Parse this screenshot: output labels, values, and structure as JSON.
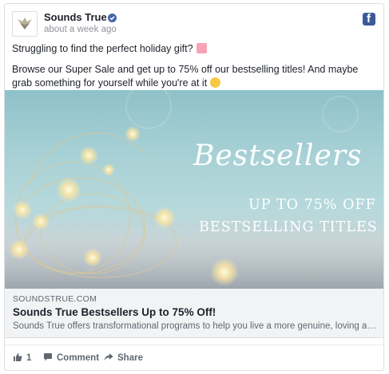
{
  "post": {
    "page_name": "Sounds True",
    "timestamp": "about a week ago",
    "message_line1": "Struggling to find the perfect holiday gift?",
    "message_line2": "Browse our Super Sale and get up to 75% off our bestselling titles! And maybe grab something for yourself while you're at it"
  },
  "hero": {
    "script_text": "Bestsellers",
    "line1": "UP TO 75% OFF",
    "line2": "BESTSELLING TITLES"
  },
  "link": {
    "domain": "SOUNDSTRUE.COM",
    "title": "Sounds True Bestsellers Up to 75% Off!",
    "description": "Sounds True offers transformational programs to help you live a more genuine, loving and ..."
  },
  "actions": {
    "like_count": "1",
    "comment_label": "Comment",
    "share_label": "Share"
  },
  "icons": [
    "facebook-logo-icon",
    "verified-badge-icon",
    "gift-emoji-icon",
    "smile-emoji-icon",
    "like-thumb-icon",
    "comment-icon",
    "share-icon"
  ],
  "colors": {
    "facebook_blue": "#3b5998",
    "verified_blue": "#4267b2",
    "link_bg": "#f2f3f5",
    "muted_text": "#606770"
  }
}
